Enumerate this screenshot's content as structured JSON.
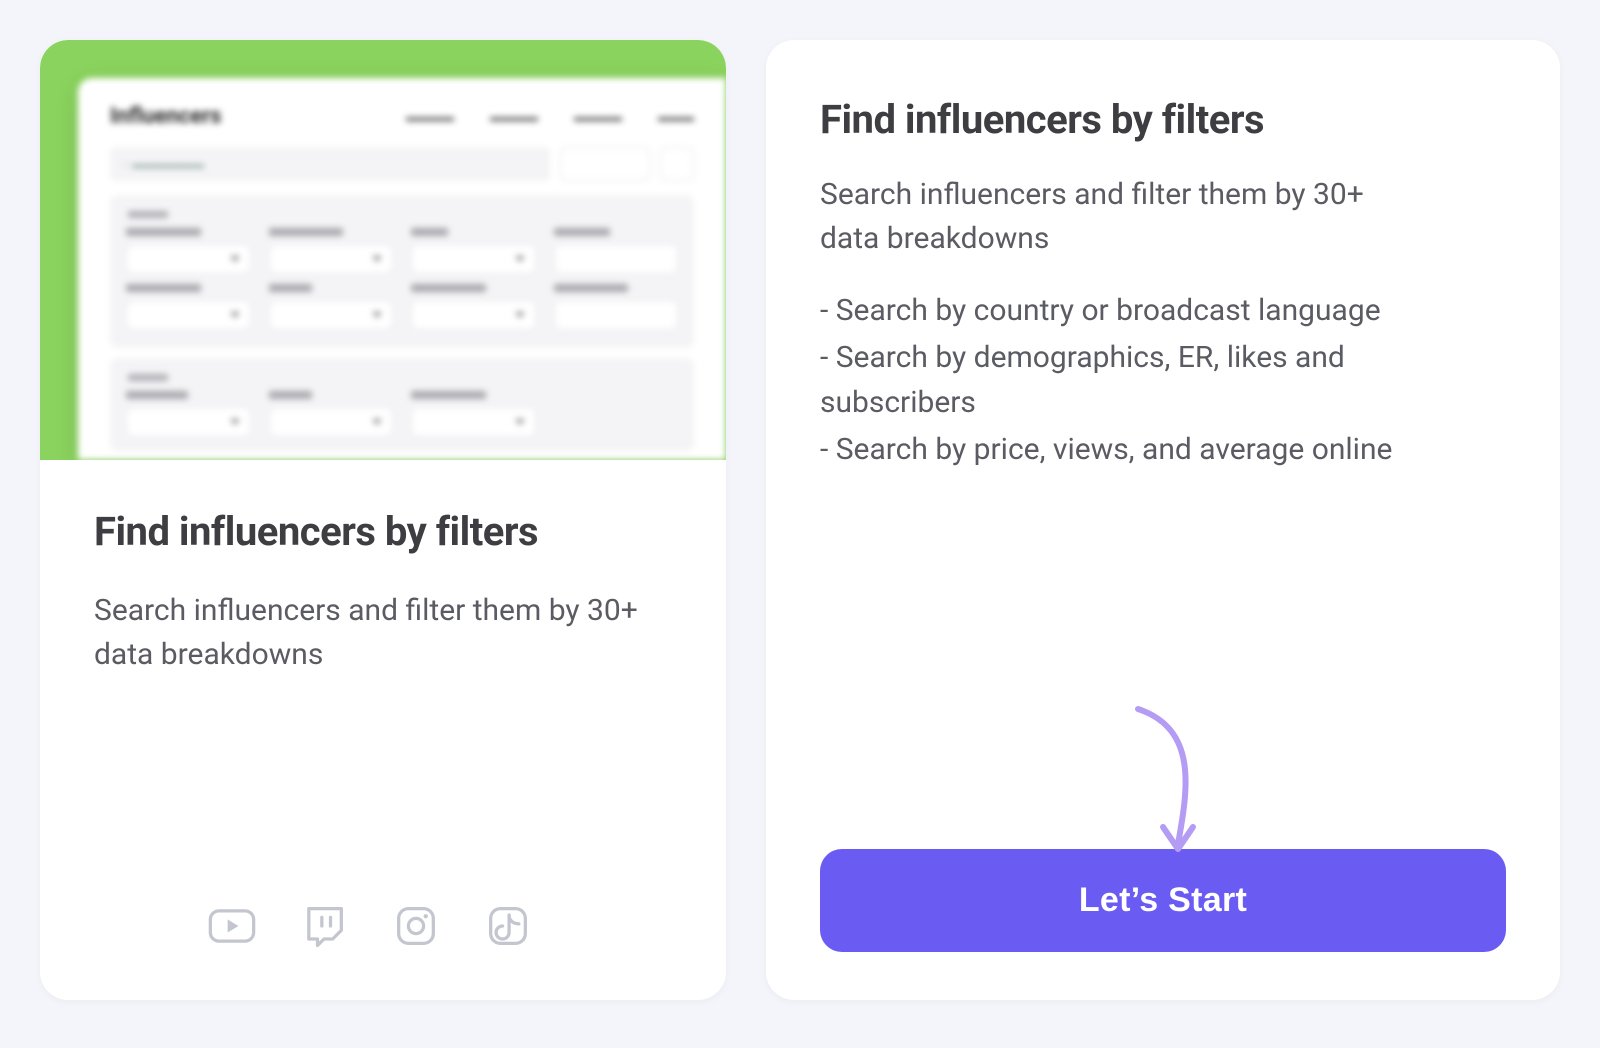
{
  "left": {
    "title": "Find influencers by filters",
    "description": "Search influencers and filter them by 30+ data breakdowns",
    "preview": {
      "heading": "Influencers"
    },
    "platforms": [
      "youtube",
      "twitch",
      "instagram",
      "tiktok"
    ]
  },
  "right": {
    "title": "Find influencers by filters",
    "subtitle": "Search influencers and filter them by 30+ data breakdowns",
    "bullets": [
      "- Search by country or broadcast language",
      "- Search by demographics, ER, likes and subscribers",
      "- Search by price, views, and average online"
    ],
    "cta_label": "Let’s Start"
  },
  "colors": {
    "accent_green": "#8ad35e",
    "cta": "#6a5cf3",
    "arrow": "#b49cf5"
  }
}
